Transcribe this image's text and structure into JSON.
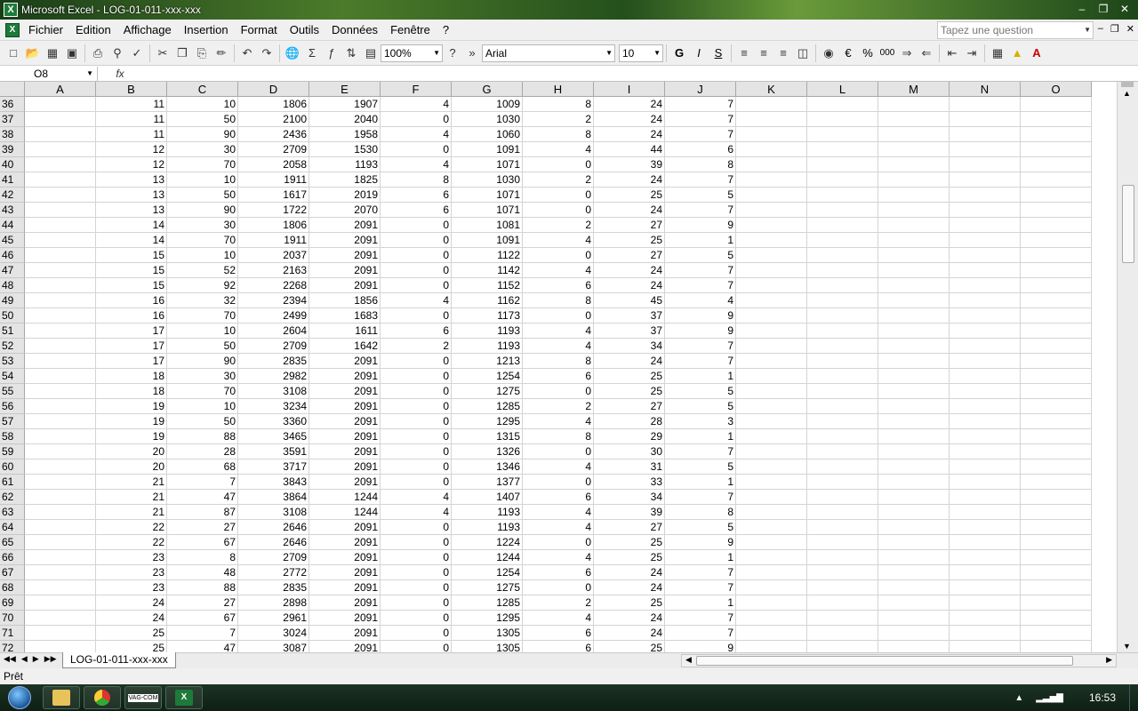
{
  "window": {
    "title": "Microsoft Excel - LOG-01-011-xxx-xxx",
    "app_icon": "excel-icon"
  },
  "menu": {
    "items": [
      "Fichier",
      "Edition",
      "Affichage",
      "Insertion",
      "Format",
      "Outils",
      "Données",
      "Fenêtre",
      "?"
    ],
    "question_placeholder": "Tapez une question"
  },
  "toolbar": {
    "zoom": "100%",
    "font_name": "Arial",
    "font_size": "10",
    "bold": "G",
    "italic": "I",
    "underline": "S",
    "currency": "€",
    "percent": "%",
    "thousands": "000"
  },
  "formula_bar": {
    "name_box": "O8",
    "fx": "fx",
    "value": ""
  },
  "grid": {
    "columns": [
      "A",
      "B",
      "C",
      "D",
      "E",
      "F",
      "G",
      "H",
      "I",
      "J",
      "K",
      "L",
      "M",
      "N",
      "O"
    ],
    "rows": [
      {
        "n": "36",
        "c": [
          "",
          "11",
          "10",
          "1806",
          "1907",
          "4",
          "1009",
          "8",
          "24",
          "7"
        ]
      },
      {
        "n": "37",
        "c": [
          "",
          "11",
          "50",
          "2100",
          "2040",
          "0",
          "1030",
          "2",
          "24",
          "7"
        ]
      },
      {
        "n": "38",
        "c": [
          "",
          "11",
          "90",
          "2436",
          "1958",
          "4",
          "1060",
          "8",
          "24",
          "7"
        ]
      },
      {
        "n": "39",
        "c": [
          "",
          "12",
          "30",
          "2709",
          "1530",
          "0",
          "1091",
          "4",
          "44",
          "6"
        ]
      },
      {
        "n": "40",
        "c": [
          "",
          "12",
          "70",
          "2058",
          "1193",
          "4",
          "1071",
          "0",
          "39",
          "8"
        ]
      },
      {
        "n": "41",
        "c": [
          "",
          "13",
          "10",
          "1911",
          "1825",
          "8",
          "1030",
          "2",
          "24",
          "7"
        ]
      },
      {
        "n": "42",
        "c": [
          "",
          "13",
          "50",
          "1617",
          "2019",
          "6",
          "1071",
          "0",
          "25",
          "5"
        ]
      },
      {
        "n": "43",
        "c": [
          "",
          "13",
          "90",
          "1722",
          "2070",
          "6",
          "1071",
          "0",
          "24",
          "7"
        ]
      },
      {
        "n": "44",
        "c": [
          "",
          "14",
          "30",
          "1806",
          "2091",
          "0",
          "1081",
          "2",
          "27",
          "9"
        ]
      },
      {
        "n": "45",
        "c": [
          "",
          "14",
          "70",
          "1911",
          "2091",
          "0",
          "1091",
          "4",
          "25",
          "1"
        ]
      },
      {
        "n": "46",
        "c": [
          "",
          "15",
          "10",
          "2037",
          "2091",
          "0",
          "1122",
          "0",
          "27",
          "5"
        ]
      },
      {
        "n": "47",
        "c": [
          "",
          "15",
          "52",
          "2163",
          "2091",
          "0",
          "1142",
          "4",
          "24",
          "7"
        ]
      },
      {
        "n": "48",
        "c": [
          "",
          "15",
          "92",
          "2268",
          "2091",
          "0",
          "1152",
          "6",
          "24",
          "7"
        ]
      },
      {
        "n": "49",
        "c": [
          "",
          "16",
          "32",
          "2394",
          "1856",
          "4",
          "1162",
          "8",
          "45",
          "4"
        ]
      },
      {
        "n": "50",
        "c": [
          "",
          "16",
          "70",
          "2499",
          "1683",
          "0",
          "1173",
          "0",
          "37",
          "9"
        ]
      },
      {
        "n": "51",
        "c": [
          "",
          "17",
          "10",
          "2604",
          "1611",
          "6",
          "1193",
          "4",
          "37",
          "9"
        ]
      },
      {
        "n": "52",
        "c": [
          "",
          "17",
          "50",
          "2709",
          "1642",
          "2",
          "1193",
          "4",
          "34",
          "7"
        ]
      },
      {
        "n": "53",
        "c": [
          "",
          "17",
          "90",
          "2835",
          "2091",
          "0",
          "1213",
          "8",
          "24",
          "7"
        ]
      },
      {
        "n": "54",
        "c": [
          "",
          "18",
          "30",
          "2982",
          "2091",
          "0",
          "1254",
          "6",
          "25",
          "1"
        ]
      },
      {
        "n": "55",
        "c": [
          "",
          "18",
          "70",
          "3108",
          "2091",
          "0",
          "1275",
          "0",
          "25",
          "5"
        ]
      },
      {
        "n": "56",
        "c": [
          "",
          "19",
          "10",
          "3234",
          "2091",
          "0",
          "1285",
          "2",
          "27",
          "5"
        ]
      },
      {
        "n": "57",
        "c": [
          "",
          "19",
          "50",
          "3360",
          "2091",
          "0",
          "1295",
          "4",
          "28",
          "3"
        ]
      },
      {
        "n": "58",
        "c": [
          "",
          "19",
          "88",
          "3465",
          "2091",
          "0",
          "1315",
          "8",
          "29",
          "1"
        ]
      },
      {
        "n": "59",
        "c": [
          "",
          "20",
          "28",
          "3591",
          "2091",
          "0",
          "1326",
          "0",
          "30",
          "7"
        ]
      },
      {
        "n": "60",
        "c": [
          "",
          "20",
          "68",
          "3717",
          "2091",
          "0",
          "1346",
          "4",
          "31",
          "5"
        ]
      },
      {
        "n": "61",
        "c": [
          "",
          "21",
          "7",
          "3843",
          "2091",
          "0",
          "1377",
          "0",
          "33",
          "1"
        ]
      },
      {
        "n": "62",
        "c": [
          "",
          "21",
          "47",
          "3864",
          "1244",
          "4",
          "1407",
          "6",
          "34",
          "7"
        ]
      },
      {
        "n": "63",
        "c": [
          "",
          "21",
          "87",
          "3108",
          "1244",
          "4",
          "1193",
          "4",
          "39",
          "8"
        ]
      },
      {
        "n": "64",
        "c": [
          "",
          "22",
          "27",
          "2646",
          "2091",
          "0",
          "1193",
          "4",
          "27",
          "5"
        ]
      },
      {
        "n": "65",
        "c": [
          "",
          "22",
          "67",
          "2646",
          "2091",
          "0",
          "1224",
          "0",
          "25",
          "9"
        ]
      },
      {
        "n": "66",
        "c": [
          "",
          "23",
          "8",
          "2709",
          "2091",
          "0",
          "1244",
          "4",
          "25",
          "1"
        ]
      },
      {
        "n": "67",
        "c": [
          "",
          "23",
          "48",
          "2772",
          "2091",
          "0",
          "1254",
          "6",
          "24",
          "7"
        ]
      },
      {
        "n": "68",
        "c": [
          "",
          "23",
          "88",
          "2835",
          "2091",
          "0",
          "1275",
          "0",
          "24",
          "7"
        ]
      },
      {
        "n": "69",
        "c": [
          "",
          "24",
          "27",
          "2898",
          "2091",
          "0",
          "1285",
          "2",
          "25",
          "1"
        ]
      },
      {
        "n": "70",
        "c": [
          "",
          "24",
          "67",
          "2961",
          "2091",
          "0",
          "1295",
          "4",
          "24",
          "7"
        ]
      },
      {
        "n": "71",
        "c": [
          "",
          "25",
          "7",
          "3024",
          "2091",
          "0",
          "1305",
          "6",
          "24",
          "7"
        ]
      },
      {
        "n": "72",
        "c": [
          "",
          "25",
          "47",
          "3087",
          "2091",
          "0",
          "1305",
          "6",
          "25",
          "9"
        ]
      }
    ]
  },
  "sheet_tab": "LOG-01-011-xxx-xxx",
  "status": "Prêt",
  "taskbar": {
    "clock": "16:53",
    "apps": [
      "explorer-icon",
      "chrome-icon",
      "vag-com-icon",
      "excel-icon"
    ],
    "vag_label": "VAG-COM"
  }
}
